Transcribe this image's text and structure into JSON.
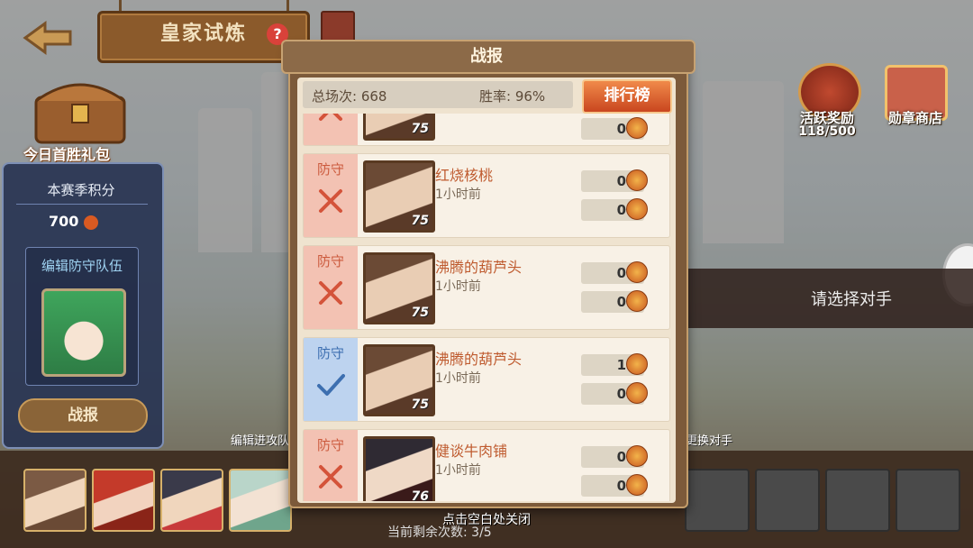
{
  "header": {
    "title": "皇家试炼",
    "help_label": "?"
  },
  "left": {
    "first_win": "今日首胜礼包",
    "season_label": "本赛季积分",
    "season_points": "700",
    "edit_defense": "编辑防守队伍",
    "report_button": "战报",
    "edit_attack": "编辑进攻队"
  },
  "right": {
    "reward_label": "活跃奖励",
    "reward_count": "118/500",
    "shop_label": "勋章商店",
    "choose_opponent": "请选择对手",
    "swap_hint": "击更换对手"
  },
  "bottom": {
    "remaining": "当前剩余次数: 3/5"
  },
  "modal": {
    "title": "战报",
    "total_label": "总场次: 668",
    "winrate_label": "胜率: 96%",
    "rank_button": "排行榜",
    "close_hint": "点击空白处关闭",
    "records": [
      {
        "type": "",
        "result": "loss",
        "name": "",
        "time": "",
        "level": "75",
        "val1": "0",
        "val2": ""
      },
      {
        "type": "防守",
        "result": "loss",
        "name": "红烧核桃",
        "time": "1小时前",
        "level": "75",
        "val1": "0",
        "val2": "0"
      },
      {
        "type": "防守",
        "result": "loss",
        "name": "沸腾的葫芦头",
        "time": "1小时前",
        "level": "75",
        "val1": "0",
        "val2": "0"
      },
      {
        "type": "防守",
        "result": "win",
        "name": "沸腾的葫芦头",
        "time": "1小时前",
        "level": "75",
        "val1": "1",
        "val2": "0"
      },
      {
        "type": "防守",
        "result": "loss",
        "name": "健谈牛肉铺",
        "time": "1小时前",
        "level": "76",
        "val1": "0",
        "val2": "0"
      }
    ]
  }
}
